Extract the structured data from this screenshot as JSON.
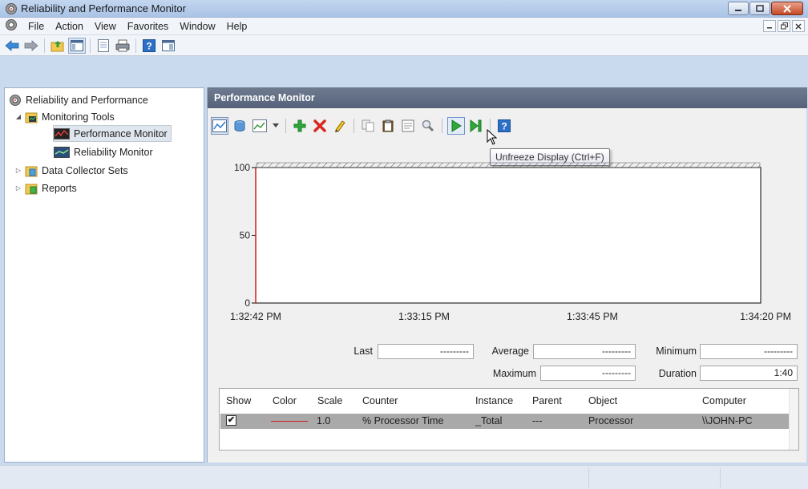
{
  "window": {
    "title": "Reliability and Performance Monitor",
    "icon": "gear-monitor-icon"
  },
  "menubar": {
    "items": [
      "File",
      "Action",
      "View",
      "Favorites",
      "Window",
      "Help"
    ]
  },
  "toolbar": {
    "buttons": [
      "back-arrow-icon",
      "forward-arrow-icon",
      "up-folder-icon",
      "show-hide-tree-icon",
      "export-list-icon",
      "print-icon",
      "help-icon",
      "properties-icon"
    ]
  },
  "tree": {
    "root": "Reliability and Performance",
    "monitoring_tools": "Monitoring Tools",
    "performance_monitor": "Performance Monitor",
    "reliability_monitor": "Reliability Monitor",
    "data_collector_sets": "Data Collector Sets",
    "reports": "Reports"
  },
  "panel": {
    "title": "Performance Monitor",
    "tooltip": "Unfreeze Display (Ctrl+F)"
  },
  "chart_data": {
    "type": "line",
    "x_labels": [
      "1:32:42 PM",
      "1:33:15 PM",
      "1:33:45 PM",
      "1:34:20 PM"
    ],
    "y_ticks": [
      "0",
      "50",
      "100"
    ],
    "ylim": [
      0,
      100
    ],
    "series": [
      {
        "color": "#d41a1a",
        "points": [
          [
            0,
            0
          ],
          [
            0,
            100
          ]
        ]
      }
    ],
    "grid": false
  },
  "stats": {
    "last_label": "Last",
    "last_value": "---------",
    "average_label": "Average",
    "average_value": "---------",
    "minimum_label": "Minimum",
    "minimum_value": "---------",
    "maximum_label": "Maximum",
    "maximum_value": "---------",
    "duration_label": "Duration",
    "duration_value": "1:40"
  },
  "counter_table": {
    "headers": [
      "Show",
      "Color",
      "Scale",
      "Counter",
      "Instance",
      "Parent",
      "Object",
      "Computer"
    ],
    "rows": [
      {
        "show": "✔",
        "color": "#d41a1a",
        "scale": "1.0",
        "counter": "% Processor Time",
        "instance": "_Total",
        "parent": "---",
        "object": "Processor",
        "computer": "\\\\JOHN-PC"
      }
    ]
  },
  "colors": {
    "accent": "#55627a",
    "series_red": "#d41a1a",
    "selection_gray": "#a9a9a9"
  }
}
